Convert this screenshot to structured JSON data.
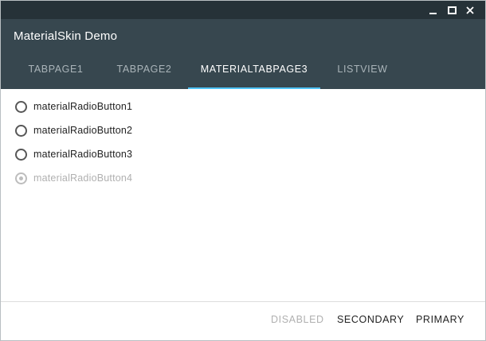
{
  "window": {
    "controls": {
      "minimize_glyph": "—",
      "maximize_glyph": "□",
      "close_glyph": "✕"
    }
  },
  "app": {
    "title": "MaterialSkin Demo"
  },
  "tabs": [
    {
      "label": "TABPAGE1",
      "active": false
    },
    {
      "label": "TABPAGE2",
      "active": false
    },
    {
      "label": "MATERIALTABPAGE3",
      "active": true
    },
    {
      "label": "LISTVIEW",
      "active": false
    }
  ],
  "radios": [
    {
      "label": "materialRadioButton1",
      "checked": false,
      "enabled": true
    },
    {
      "label": "materialRadioButton2",
      "checked": false,
      "enabled": true
    },
    {
      "label": "materialRadioButton3",
      "checked": false,
      "enabled": true
    },
    {
      "label": "materialRadioButton4",
      "checked": true,
      "enabled": false
    }
  ],
  "footer": {
    "disabled_label": "DISABLED",
    "secondary_label": "SECONDARY",
    "primary_label": "PRIMARY"
  },
  "colors": {
    "titlebar": "#263238",
    "header": "#37474f",
    "accent": "#4fc3f7",
    "tab_inactive_text": "#aab4b9",
    "disabled_text": "#b0b0b0"
  }
}
